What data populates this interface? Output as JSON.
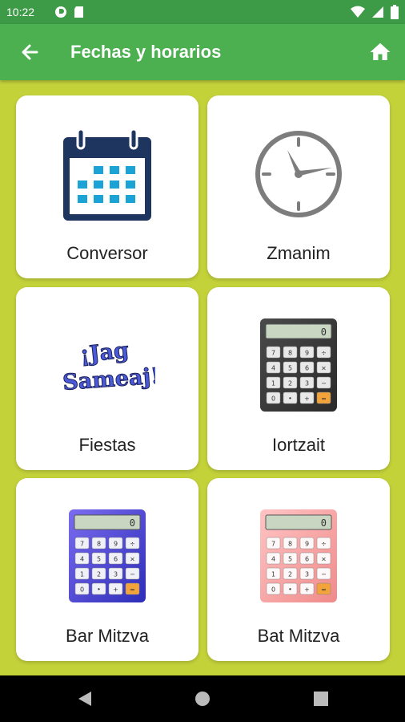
{
  "status": {
    "time": "10:22"
  },
  "header": {
    "title": "Fechas y horarios"
  },
  "cards": [
    {
      "label": "Conversor",
      "icon": "calendar-icon"
    },
    {
      "label": "Zmanim",
      "icon": "clock-icon"
    },
    {
      "label": "Fiestas",
      "icon": "jag-sameaj-icon",
      "icon_text": [
        "¡Jag",
        "Sameaj!"
      ]
    },
    {
      "label": "Iortzait",
      "icon": "calculator-dark-icon"
    },
    {
      "label": "Bar Mitzva",
      "icon": "calculator-blue-icon"
    },
    {
      "label": "Bat Mitzva",
      "icon": "calculator-pink-icon"
    }
  ],
  "calc_keys": [
    "7",
    "8",
    "9",
    "÷",
    "4",
    "5",
    "6",
    "×",
    "1",
    "2",
    "3",
    "−",
    "0",
    "•",
    "+",
    "="
  ],
  "calc_display": "0",
  "colors": {
    "app_bar": "#4caf50",
    "status_bar": "#3d9a47",
    "background": "#c4d23a"
  }
}
